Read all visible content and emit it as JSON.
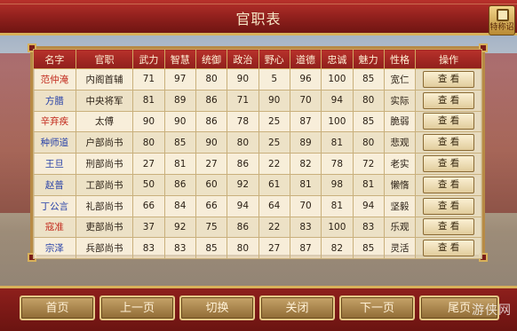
{
  "title": "官职表",
  "corner_badge": "特称诏",
  "table": {
    "headers": [
      "名字",
      "官职",
      "武力",
      "智慧",
      "统御",
      "政治",
      "野心",
      "道德",
      "忠诚",
      "魅力",
      "性格",
      "操作"
    ],
    "rows": [
      {
        "name": "范仲淹",
        "name_color": "red",
        "post": "内阁首辅",
        "wuli": "71",
        "zhihui": "97",
        "tongyu": "80",
        "zhengzhi": "90",
        "yexin": "5",
        "daode": "96",
        "zhongcheng": "100",
        "meili": "85",
        "xingge": "宽仁",
        "action": "查 看"
      },
      {
        "name": "方腊",
        "name_color": "blue",
        "post": "中央将军",
        "wuli": "81",
        "zhihui": "89",
        "tongyu": "86",
        "zhengzhi": "71",
        "yexin": "90",
        "daode": "70",
        "zhongcheng": "94",
        "meili": "80",
        "xingge": "实际",
        "action": "查 看"
      },
      {
        "name": "辛弃疾",
        "name_color": "red",
        "post": "太傅",
        "wuli": "90",
        "zhihui": "90",
        "tongyu": "86",
        "zhengzhi": "78",
        "yexin": "25",
        "daode": "87",
        "zhongcheng": "100",
        "meili": "85",
        "xingge": "脆弱",
        "action": "查 看"
      },
      {
        "name": "种师道",
        "name_color": "blue",
        "post": "户部尚书",
        "wuli": "80",
        "zhihui": "85",
        "tongyu": "90",
        "zhengzhi": "80",
        "yexin": "25",
        "daode": "89",
        "zhongcheng": "81",
        "meili": "80",
        "xingge": "悲观",
        "action": "查 看"
      },
      {
        "name": "王旦",
        "name_color": "blue",
        "post": "刑部尚书",
        "wuli": "27",
        "zhihui": "81",
        "tongyu": "27",
        "zhengzhi": "86",
        "yexin": "22",
        "daode": "82",
        "zhongcheng": "78",
        "meili": "72",
        "xingge": "老实",
        "action": "查 看"
      },
      {
        "name": "赵普",
        "name_color": "blue",
        "post": "工部尚书",
        "wuli": "50",
        "zhihui": "86",
        "tongyu": "60",
        "zhengzhi": "92",
        "yexin": "61",
        "daode": "81",
        "zhongcheng": "98",
        "meili": "81",
        "xingge": "懒惰",
        "action": "查 看"
      },
      {
        "name": "丁公言",
        "name_color": "blue",
        "post": "礼部尚书",
        "wuli": "66",
        "zhihui": "84",
        "tongyu": "66",
        "zhengzhi": "94",
        "yexin": "64",
        "daode": "70",
        "zhongcheng": "81",
        "meili": "94",
        "xingge": "坚毅",
        "action": "查 看"
      },
      {
        "name": "寇准",
        "name_color": "red",
        "post": "吏部尚书",
        "wuli": "37",
        "zhihui": "92",
        "tongyu": "75",
        "zhengzhi": "86",
        "yexin": "22",
        "daode": "83",
        "zhongcheng": "100",
        "meili": "83",
        "xingge": "乐观",
        "action": "查 看"
      },
      {
        "name": "宗泽",
        "name_color": "blue",
        "post": "兵部尚书",
        "wuli": "83",
        "zhihui": "83",
        "tongyu": "85",
        "zhengzhi": "80",
        "yexin": "27",
        "daode": "87",
        "zhongcheng": "82",
        "meili": "85",
        "xingge": "灵活",
        "action": "查 看"
      }
    ]
  },
  "buttons": {
    "home": "首页",
    "prev": "上一页",
    "switch": "切换",
    "close": "关闭",
    "next": "下一页",
    "last": "尾页"
  },
  "watermark": "游侠网",
  "colors": {
    "header_red": "#b8312b",
    "name_red": "#c22a1d",
    "name_blue": "#2640a8",
    "gold_border": "#d8b15a"
  }
}
